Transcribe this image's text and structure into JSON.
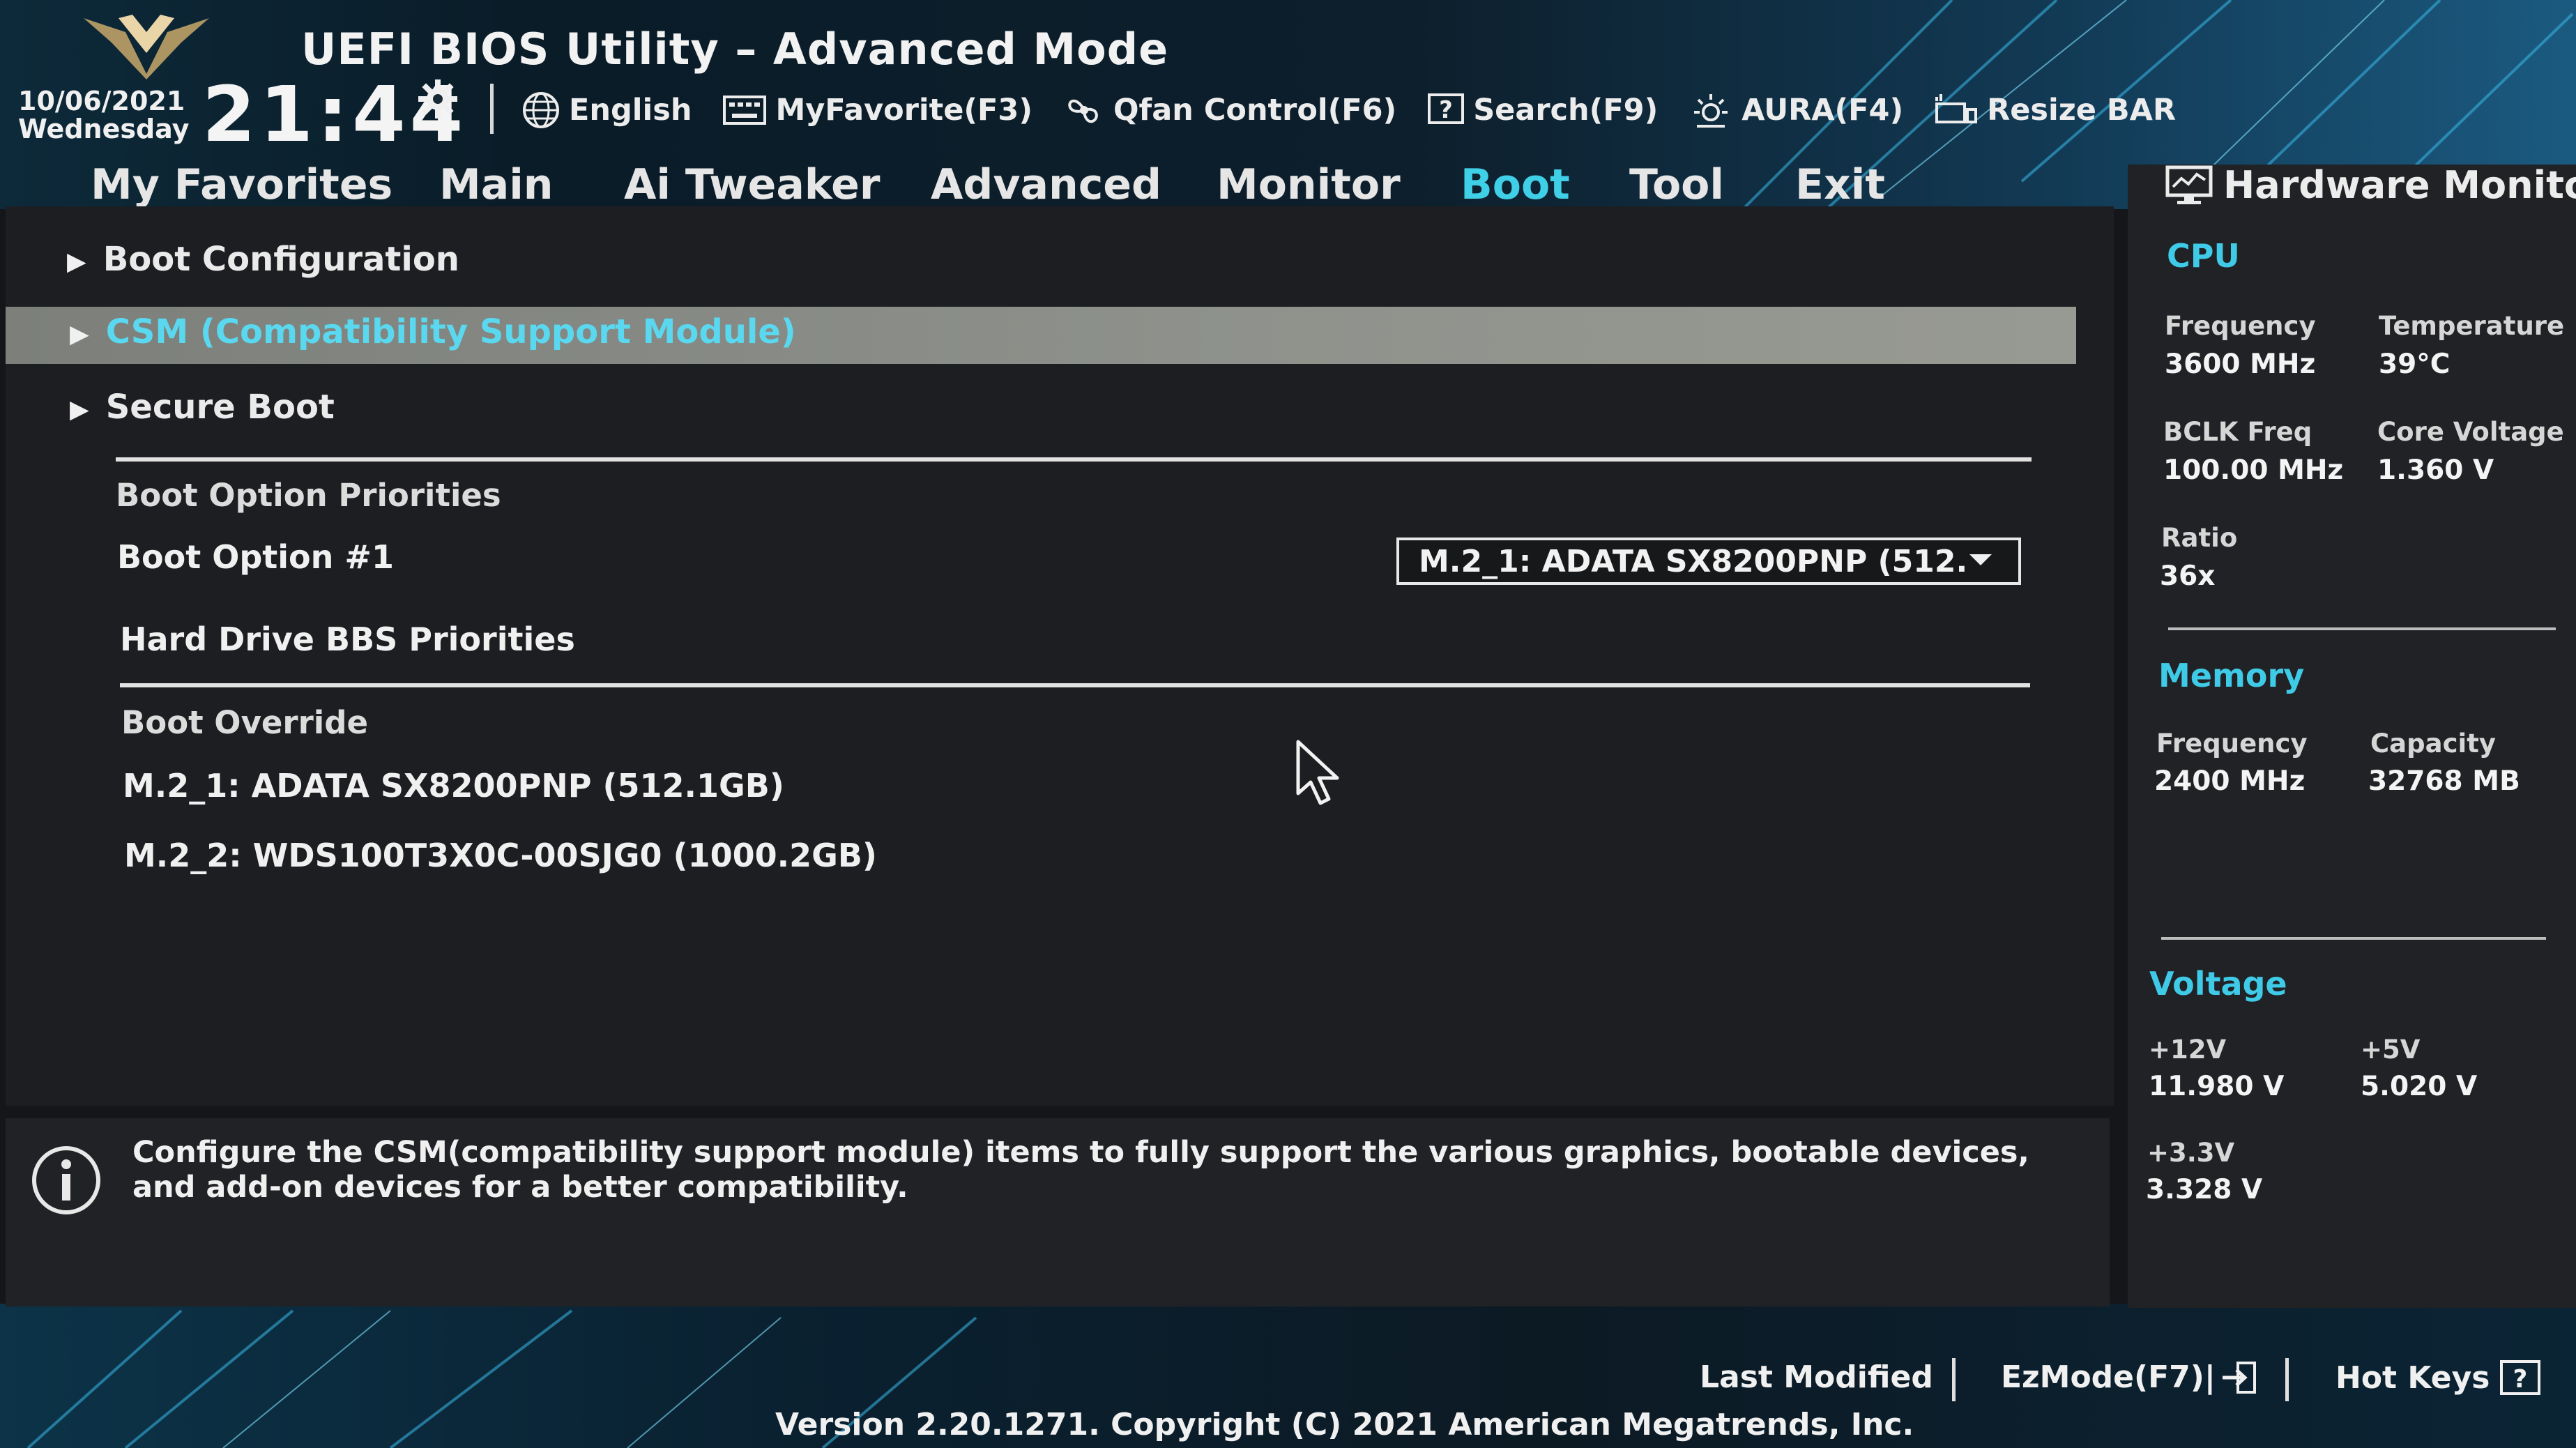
{
  "header": {
    "title": "UEFI BIOS Utility – Advanced Mode",
    "date": "10/06/2021",
    "weekday": "Wednesday",
    "time": "21:44",
    "toolbar": {
      "language": "English",
      "my_favorite": "MyFavorite(F3)",
      "qfan": "Qfan Control(F6)",
      "search": "Search(F9)",
      "aura": "AURA(F4)",
      "resize_bar": "Resize BAR"
    }
  },
  "tabs": [
    {
      "label": "My Favorites"
    },
    {
      "label": "Main"
    },
    {
      "label": "Ai Tweaker"
    },
    {
      "label": "Advanced"
    },
    {
      "label": "Monitor"
    },
    {
      "label": "Boot",
      "active": true
    },
    {
      "label": "Tool"
    },
    {
      "label": "Exit"
    }
  ],
  "boot": {
    "submenus": [
      {
        "label": "Boot Configuration"
      },
      {
        "label": "CSM (Compatibility Support Module)",
        "selected": true
      },
      {
        "label": "Secure Boot"
      }
    ],
    "boot_option_priorities_label": "Boot Option Priorities",
    "boot_option_1_label": "Boot Option #1",
    "boot_option_1_value": "M.2_1: ADATA SX8200PNP (512.",
    "hard_drive_bbs_label": "Hard Drive BBS Priorities",
    "boot_override_label": "Boot Override",
    "override_devices": [
      {
        "label": "M.2_1: ADATA SX8200PNP (512.1GB)"
      },
      {
        "label": "M.2_2: WDS100T3X0C-00SJG0 (1000.2GB)"
      }
    ]
  },
  "help": {
    "text": "Configure the CSM(compatibility support module) items to fully support the various graphics, bootable devices, and add-on devices for a better compatibility."
  },
  "hardware_monitor": {
    "title": "Hardware Monitor",
    "cpu": {
      "section": "CPU",
      "frequency_label": "Frequency",
      "frequency_value": "3600 MHz",
      "temperature_label": "Temperature",
      "temperature_value": "39°C",
      "bclk_label": "BCLK Freq",
      "bclk_value": "100.00 MHz",
      "core_voltage_label": "Core Voltage",
      "core_voltage_value": "1.360 V",
      "ratio_label": "Ratio",
      "ratio_value": "36x"
    },
    "memory": {
      "section": "Memory",
      "frequency_label": "Frequency",
      "frequency_value": "2400 MHz",
      "capacity_label": "Capacity",
      "capacity_value": "32768 MB"
    },
    "voltage": {
      "section": "Voltage",
      "v12_label": "+12V",
      "v12_value": "11.980 V",
      "v5_label": "+5V",
      "v5_value": "5.020 V",
      "v33_label": "+3.3V",
      "v33_value": "3.328 V"
    }
  },
  "footer": {
    "last_modified": "Last Modified",
    "ezmode": "EzMode(F7)|",
    "hot_keys": "Hot Keys",
    "version": "Version 2.20.1271. Copyright (C) 2021 American Megatrends, Inc."
  },
  "colors": {
    "accent": "#3fd0e8",
    "selected_row": "#8f928c",
    "panel": "#1d1e21",
    "background": "#141619"
  }
}
